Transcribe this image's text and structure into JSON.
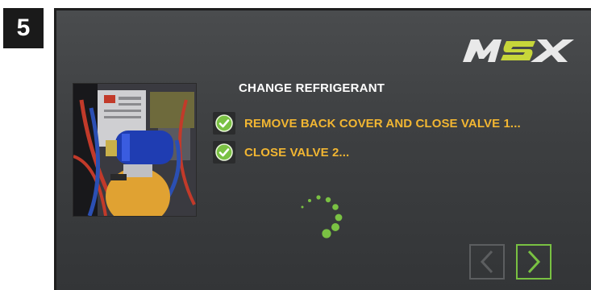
{
  "step": {
    "number": "5"
  },
  "header": {
    "logo_text": "MSX",
    "logo_icon": "msx-logo"
  },
  "photo": {
    "icon": "refrigerant-tank-photo"
  },
  "main": {
    "title": "CHANGE REFRIGERANT",
    "tasks": [
      {
        "label": "REMOVE BACK COVER AND CLOSE VALVE 1...",
        "status": "done",
        "icon": "check-circle-icon"
      },
      {
        "label": "CLOSE VALVE 2...",
        "status": "done",
        "icon": "check-circle-icon"
      }
    ]
  },
  "spinner": {
    "icon": "loading-spinner-icon"
  },
  "nav": {
    "prev": {
      "icon": "chevron-left-icon",
      "enabled": false
    },
    "next": {
      "icon": "chevron-right-icon",
      "enabled": true
    }
  },
  "colors": {
    "screen_bg": "#3f4143",
    "task_text": "#f2b632",
    "check_green": "#7ac143",
    "logo_accent": "#c7d63a",
    "next_border": "#79c142",
    "prev_border": "#5c5e60"
  }
}
